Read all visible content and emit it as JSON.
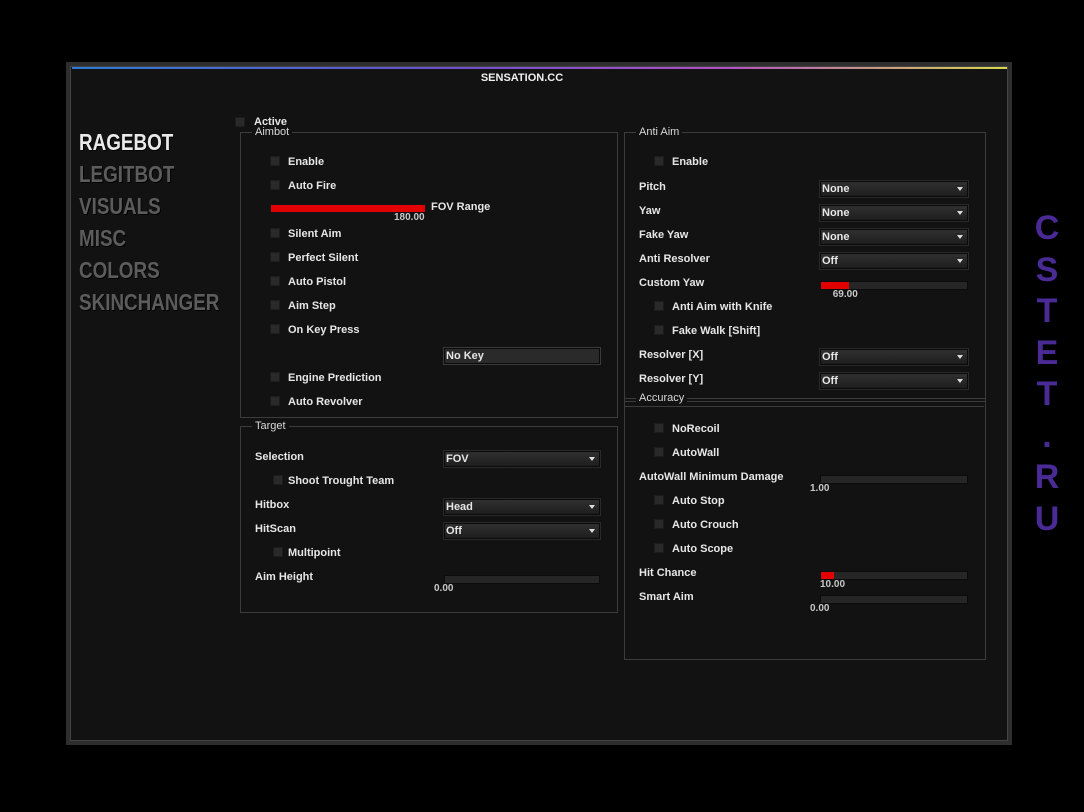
{
  "window": {
    "title": "SENSATION.CC",
    "accent_gradient": [
      "#2b7bd6",
      "#b24fc4",
      "#d8d84a"
    ]
  },
  "nav": {
    "items": [
      {
        "label": "RAGEBOT",
        "active": true
      },
      {
        "label": "LEGITBOT"
      },
      {
        "label": "VISUALS"
      },
      {
        "label": "MISC"
      },
      {
        "label": "COLORS"
      },
      {
        "label": "SKINCHANGER"
      }
    ]
  },
  "active": {
    "label": "Active",
    "checked": false
  },
  "aimbot": {
    "title": "Aimbot",
    "controls": [
      {
        "type": "checkbox",
        "label": "Enable",
        "checked": false
      },
      {
        "type": "checkbox",
        "label": "Auto Fire",
        "checked": false
      },
      {
        "type": "slider",
        "label": "FOV Range",
        "value": "180.00",
        "fill": 1.0
      },
      {
        "type": "checkbox",
        "label": "Silent Aim",
        "checked": false
      },
      {
        "type": "checkbox",
        "label": "Perfect Silent",
        "checked": false
      },
      {
        "type": "checkbox",
        "label": "Auto Pistol",
        "checked": false
      },
      {
        "type": "checkbox",
        "label": "Aim Step",
        "checked": false
      },
      {
        "type": "checkbox",
        "label": "On Key Press",
        "checked": false
      },
      {
        "type": "keybind",
        "value": "No Key"
      },
      {
        "type": "checkbox",
        "label": "Engine Prediction",
        "checked": false
      },
      {
        "type": "checkbox",
        "label": "Auto Revolver",
        "checked": false
      }
    ]
  },
  "target": {
    "title": "Target",
    "controls": [
      {
        "type": "dropdown",
        "label": "Selection",
        "value": "FOV"
      },
      {
        "type": "checkbox",
        "label": "Shoot Trought Team",
        "checked": false
      },
      {
        "type": "dropdown",
        "label": "Hitbox",
        "value": "Head"
      },
      {
        "type": "dropdown",
        "label": "HitScan",
        "value": "Off"
      },
      {
        "type": "checkbox",
        "label": "Multipoint",
        "checked": false
      },
      {
        "type": "slider",
        "label": "Aim Height",
        "value": "0.00",
        "fill": 0
      }
    ]
  },
  "antiaim": {
    "title": "Anti Aim",
    "controls": [
      {
        "type": "checkbox",
        "label": "Enable",
        "checked": false
      },
      {
        "type": "dropdown",
        "label": "Pitch",
        "value": "None"
      },
      {
        "type": "dropdown",
        "label": "Yaw",
        "value": "None"
      },
      {
        "type": "dropdown",
        "label": "Fake Yaw",
        "value": "None"
      },
      {
        "type": "dropdown",
        "label": "Anti Resolver",
        "value": "Off"
      },
      {
        "type": "slider",
        "label": "Custom Yaw",
        "value": "69.00",
        "fill": 0.19
      },
      {
        "type": "checkbox",
        "label": "Anti Aim with Knife",
        "checked": false
      },
      {
        "type": "checkbox",
        "label": "Fake Walk [Shift]",
        "checked": false
      },
      {
        "type": "dropdown",
        "label": "Resolver [X]",
        "value": "Off"
      },
      {
        "type": "dropdown",
        "label": "Resolver [Y]",
        "value": "Off"
      }
    ]
  },
  "accuracy": {
    "title": "Accuracy",
    "controls": [
      {
        "type": "checkbox",
        "label": "NoRecoil",
        "checked": false
      },
      {
        "type": "checkbox",
        "label": "AutoWall",
        "checked": false
      },
      {
        "type": "slider",
        "label": "AutoWall Minimum Damage",
        "value": "1.00",
        "fill": 0
      },
      {
        "type": "checkbox",
        "label": "Auto Stop",
        "checked": false
      },
      {
        "type": "checkbox",
        "label": "Auto Crouch",
        "checked": false
      },
      {
        "type": "checkbox",
        "label": "Auto Scope",
        "checked": false
      },
      {
        "type": "slider",
        "label": "Hit Chance",
        "value": "10.00",
        "fill": 0.09
      },
      {
        "type": "slider",
        "label": "Smart Aim",
        "value": "0.00",
        "fill": 0
      }
    ]
  },
  "watermark": {
    "text": "CSTET.RU",
    "color": "#4a2b96"
  },
  "colors": {
    "slider_fill": "#e30000"
  }
}
